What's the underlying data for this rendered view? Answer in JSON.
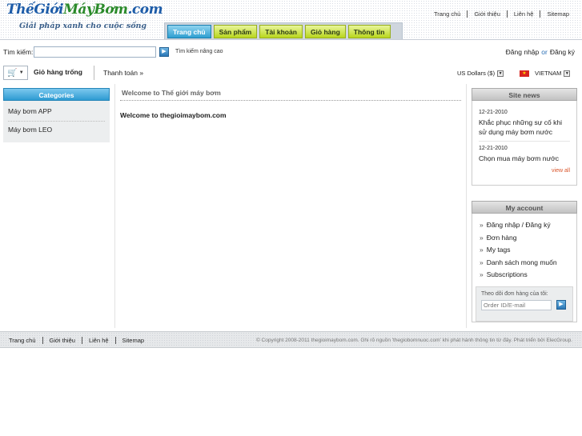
{
  "logo": {
    "brand_a": "ThếGiới",
    "brand_b": "MáyBơm",
    "brand_c": ".com",
    "tagline": "Giải pháp xanh cho cuộc sống"
  },
  "top_links": [
    "Trang chủ",
    "Giới thiệu",
    "Liên hệ",
    "Sitemap"
  ],
  "tabs": [
    "Trang chủ",
    "Sản phẩm",
    "Tài khoản",
    "Giỏ hàng",
    "Thông tin"
  ],
  "search": {
    "label": "Tìm kiếm:",
    "value": "",
    "placeholder": "",
    "advanced": "Tìm kiếm nâng cao"
  },
  "auth": {
    "login": "Đăng nhập",
    "or": "or",
    "register": "Đăng ký"
  },
  "cart": {
    "empty_label": "Giỏ hàng trống",
    "checkout": "Thanh toán »"
  },
  "currency": "US Dollars ($)",
  "country": "VIETNAM",
  "colors": {
    "tab_active": "#2f9fd1",
    "tab_default": "#b9d61e",
    "view_all": "#d9542a"
  },
  "categories": {
    "title": "Categories",
    "items": [
      "Máy bơm APP",
      "Máy bơm LEO"
    ]
  },
  "main": {
    "title": "Welcome to Thế giới máy bơm",
    "body": "Welcome to thegioimaybom.com"
  },
  "site_news": {
    "title": "Site news",
    "items": [
      {
        "date": "12-21-2010",
        "title": "Khắc phục những sự cố khi sử dụng máy bơm nước"
      },
      {
        "date": "12-21-2010",
        "title": "Chọn mua máy bơm nước"
      }
    ],
    "view_all": "view all"
  },
  "my_account": {
    "title": "My account",
    "items": [
      "Đăng nhập / Đăng ký",
      "Đơn hàng",
      "My tags",
      "Danh sách mong muốn",
      "Subscriptions"
    ],
    "track_label": "Theo dõi đơn hàng của tôi:",
    "track_placeholder": "Order ID/E-mail"
  },
  "footer": {
    "links": [
      "Trang chủ",
      "Giới thiệu",
      "Liên hệ",
      "Sitemap"
    ],
    "copyright": "© Copyright 2008-2011 thegioimaybom.com.   Ghi rõ nguồn 'thegiobomnuoc.com' khi phát hành thông tin từ đây. Phát triển bởi ElecGroup."
  }
}
